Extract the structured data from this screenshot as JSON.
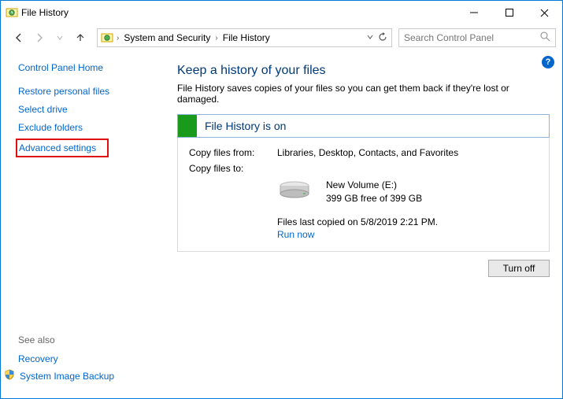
{
  "window": {
    "title": "File History"
  },
  "nav": {
    "breadcrumb": {
      "seg1": "System and Security",
      "seg2": "File History"
    },
    "search_placeholder": "Search Control Panel"
  },
  "sidebar": {
    "home": "Control Panel Home",
    "links": {
      "restore": "Restore personal files",
      "select_drive": "Select drive",
      "exclude": "Exclude folders",
      "advanced": "Advanced settings"
    },
    "see_also": "See also",
    "recovery": "Recovery",
    "system_image": "System Image Backup"
  },
  "main": {
    "heading": "Keep a history of your files",
    "description": "File History saves copies of your files so you can get them back if they're lost or damaged.",
    "status_label": "File History is on",
    "copy_from_label": "Copy files from:",
    "copy_from_value": "Libraries, Desktop, Contacts, and Favorites",
    "copy_to_label": "Copy files to:",
    "drive_name": "New Volume (E:)",
    "drive_free": "399 GB free of 399 GB",
    "last_copied": "Files last copied on 5/8/2019 2:21 PM.",
    "run_now": "Run now",
    "turn_off": "Turn off"
  },
  "help_glyph": "?"
}
